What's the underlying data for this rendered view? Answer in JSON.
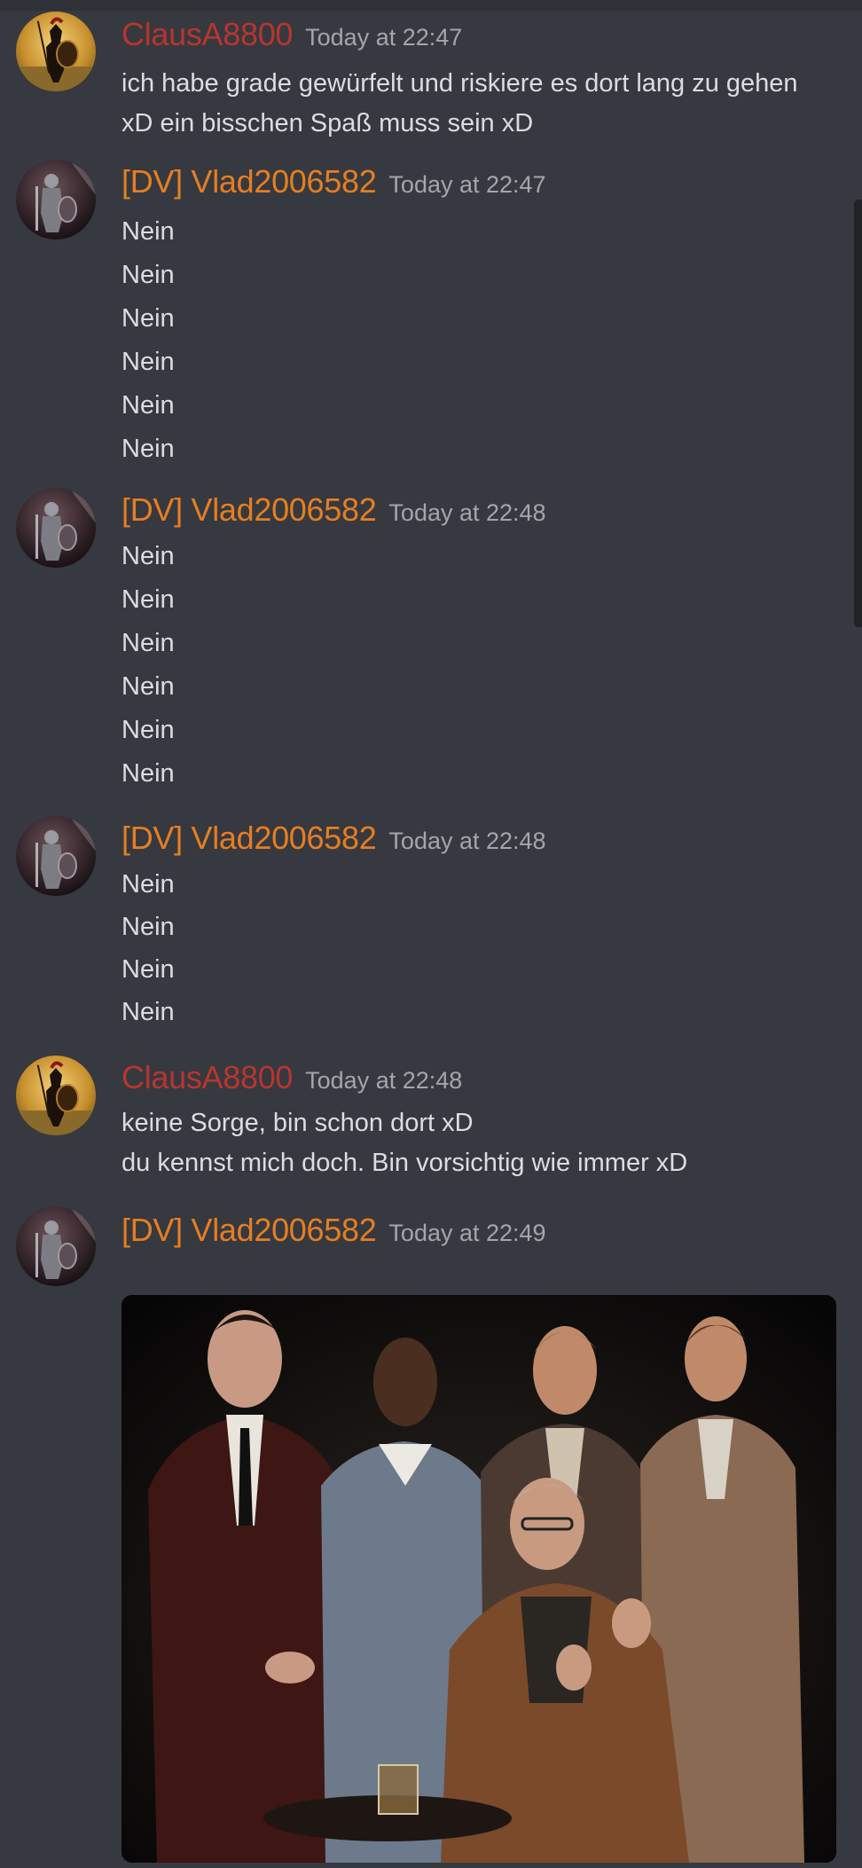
{
  "messages": [
    {
      "author": "ClausA8800",
      "author_color": "#b8352f",
      "timestamp": "Today at 22:47",
      "avatar_icon": "spartan-warrior-avatar",
      "lines": [
        "ich habe grade gewürfelt und riskiere es dort lang zu gehen",
        "xD ein bisschen Spaß muss sein xD"
      ]
    },
    {
      "author": "[DV] Vlad2006582",
      "author_color": "#e67e22",
      "timestamp": "Today at 22:47",
      "avatar_icon": "armored-knight-avatar",
      "lines": [
        "Nein",
        "Nein",
        "Nein",
        "Nein",
        "Nein",
        "Nein"
      ]
    },
    {
      "author": "[DV] Vlad2006582",
      "author_color": "#e67e22",
      "timestamp": "Today at 22:48",
      "avatar_icon": "armored-knight-avatar",
      "lines": [
        "Nein",
        "Nein",
        "Nein",
        "Nein",
        "Nein",
        "Nein"
      ]
    },
    {
      "author": "[DV] Vlad2006582",
      "author_color": "#e67e22",
      "timestamp": "Today at 22:48",
      "avatar_icon": "armored-knight-avatar",
      "lines": [
        "Nein",
        "Nein",
        "Nein",
        "Nein"
      ]
    },
    {
      "author": "ClausA8800",
      "author_color": "#b8352f",
      "timestamp": "Today at 22:48",
      "avatar_icon": "spartan-warrior-avatar",
      "lines": [
        "keine Sorge, bin schon dort xD",
        "du kennst mich doch. Bin vorsichtig wie immer xD"
      ]
    },
    {
      "author": "[DV] Vlad2006582",
      "author_color": "#e67e22",
      "timestamp": "Today at 22:49",
      "avatar_icon": "armored-knight-avatar",
      "lines": [],
      "attachment": "gif-five-men-in-suits"
    }
  ],
  "theme": {
    "background": "#36393f",
    "text": "#dcddde",
    "timestamp": "#a3a6aa"
  }
}
